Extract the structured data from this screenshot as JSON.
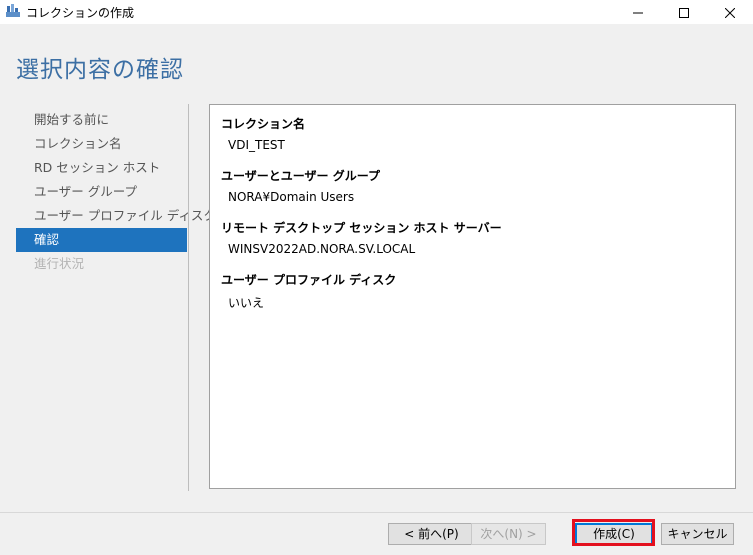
{
  "window": {
    "title": "コレクションの作成",
    "icons": [
      "app-icon",
      "minimize-icon",
      "maximize-icon",
      "close-icon"
    ]
  },
  "page": {
    "title": "選択内容の確認"
  },
  "nav": {
    "items": [
      {
        "label": "開始する前に",
        "state": "normal"
      },
      {
        "label": "コレクション名",
        "state": "normal"
      },
      {
        "label": "RD セッション ホスト",
        "state": "normal"
      },
      {
        "label": "ユーザー グループ",
        "state": "normal"
      },
      {
        "label": "ユーザー プロファイル ディスク",
        "state": "normal"
      },
      {
        "label": "確認",
        "state": "active"
      },
      {
        "label": "進行状況",
        "state": "disabled"
      }
    ]
  },
  "summary": {
    "sections": [
      {
        "title": "コレクション名",
        "value": "VDI_TEST"
      },
      {
        "title": "ユーザーとユーザー グループ",
        "value": "NORA¥Domain Users"
      },
      {
        "title": "リモート デスクトップ セッション ホスト サーバー",
        "value": "WINSV2022AD.NORA.SV.LOCAL"
      },
      {
        "title": "ユーザー プロファイル ディスク",
        "value": "いいえ"
      }
    ]
  },
  "footer": {
    "prev_label": "< 前へ(P)",
    "next_label": "次へ(N) >",
    "create_label": "作成(C)",
    "cancel_label": "キャンセル"
  },
  "colors": {
    "accent": "#1e73be",
    "title_blue": "#3c6fa4",
    "highlight_red": "#e3101e"
  }
}
